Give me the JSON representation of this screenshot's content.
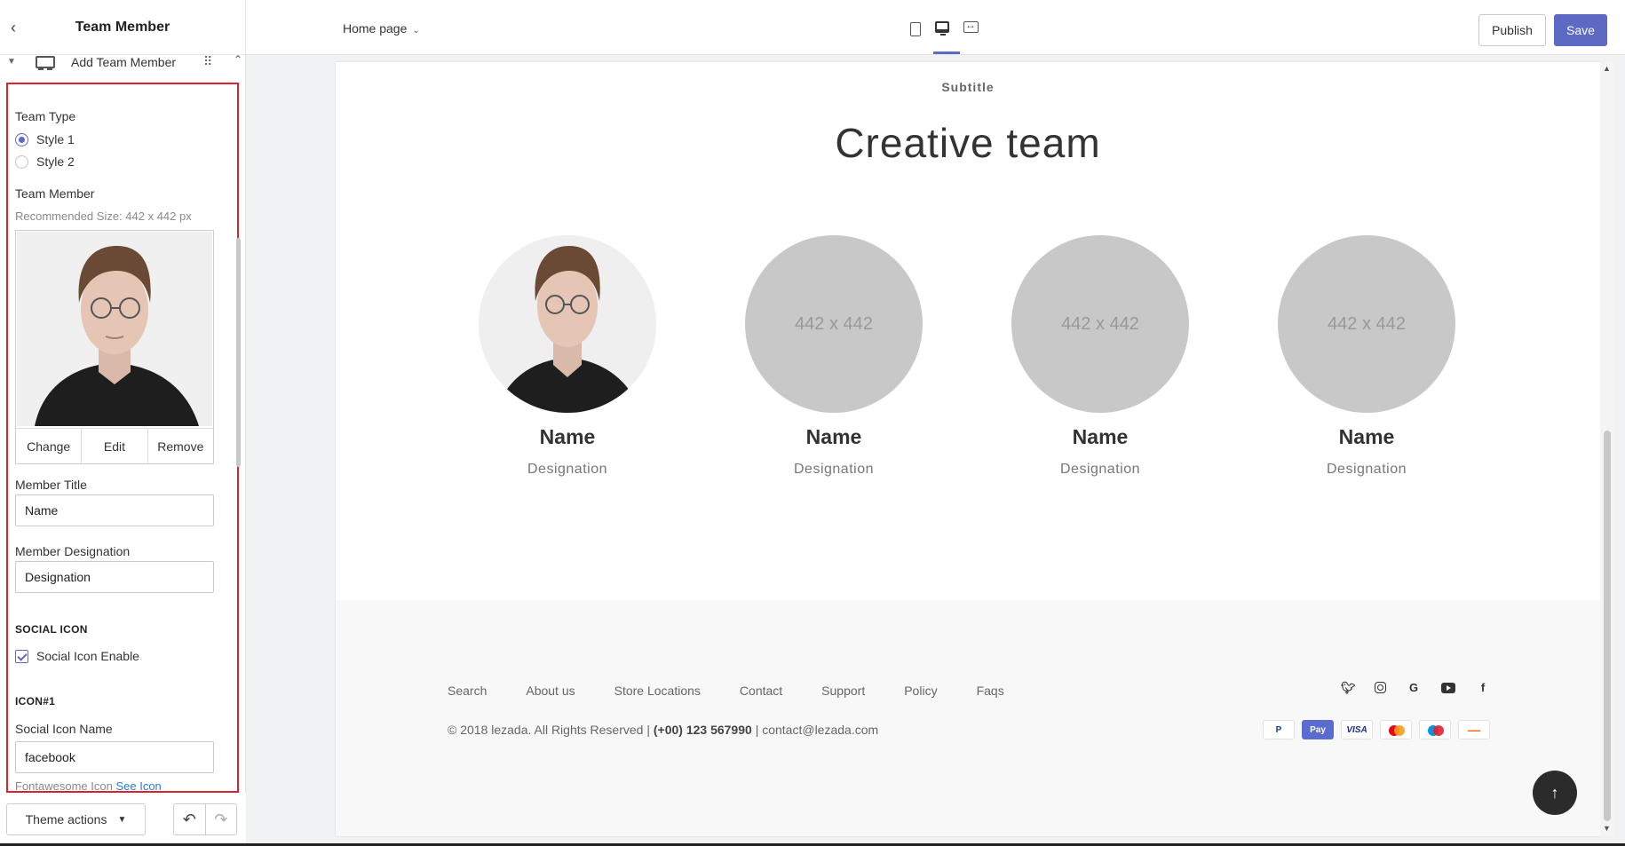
{
  "sidebar": {
    "title": "Team Member",
    "block_label": "Add Team Member",
    "team_type_label": "Team Type",
    "team_type_options": [
      "Style 1",
      "Style 2"
    ],
    "team_member_label": "Team Member",
    "recommended_size": "Recommended Size: 442 x 442 px",
    "image_buttons": [
      "Change",
      "Edit",
      "Remove"
    ],
    "member_title_label": "Member Title",
    "member_title_value": "Name",
    "member_designation_label": "Member Designation",
    "member_designation_value": "Designation",
    "social_icon_heading": "SOCIAL ICON",
    "social_icon_enable_label": "Social Icon Enable",
    "icon_heading": "ICON#1",
    "social_icon_name_label": "Social Icon Name",
    "social_icon_name_value": "facebook",
    "fontawesome_text": "Fontawesome Icon",
    "see_icon_link": "See Icon",
    "theme_actions": "Theme actions"
  },
  "topbar": {
    "page_selector": "Home page",
    "publish": "Publish",
    "save": "Save"
  },
  "preview": {
    "subtitle": "Subtitle",
    "title": "Creative team",
    "members": [
      {
        "name": "Name",
        "designation": "Designation",
        "placeholder": ""
      },
      {
        "name": "Name",
        "designation": "Designation",
        "placeholder": "442 x 442"
      },
      {
        "name": "Name",
        "designation": "Designation",
        "placeholder": "442 x 442"
      },
      {
        "name": "Name",
        "designation": "Designation",
        "placeholder": "442 x 442"
      }
    ],
    "footer_links": [
      "Search",
      "About us",
      "Store Locations",
      "Contact",
      "Support",
      "Policy",
      "Faqs"
    ],
    "copyright_prefix": "© 2018 lezada. All Rights Reserved |",
    "phone": "(+00) 123 567990",
    "email_text": "| contact@lezada.com",
    "social_icons": [
      "twitter-icon",
      "instagram-icon",
      "google-icon",
      "youtube-icon",
      "facebook-icon"
    ],
    "payments": [
      "P",
      "Pay",
      "VISA",
      "",
      "",
      "—"
    ]
  },
  "colors": {
    "accent": "#5c6ac4",
    "highlight_border": "#d9232f",
    "placeholder_circle": "#c8c8c8"
  }
}
